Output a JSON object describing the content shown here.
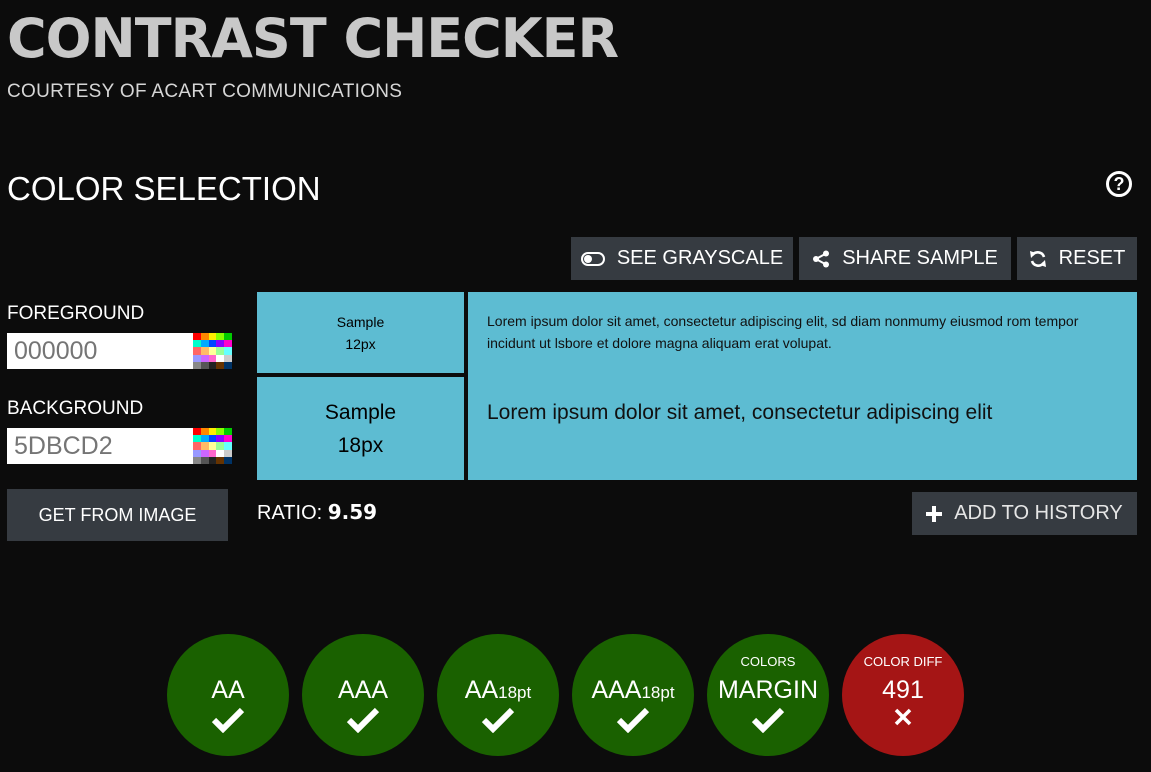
{
  "header": {
    "title": "CONTRAST CHECKER",
    "subtitle": "COURTESY OF ACART COMMUNICATIONS"
  },
  "section": {
    "title": "COLOR SELECTION",
    "help_icon": "question-circle-icon"
  },
  "toolbar": {
    "grayscale_label": "SEE GRAYSCALE",
    "grayscale_icon": "toggle-icon",
    "share_label": "SHARE SAMPLE",
    "share_icon": "share-icon",
    "reset_label": "RESET",
    "reset_icon": "refresh-icon"
  },
  "foreground": {
    "label": "FOREGROUND",
    "placeholder": "000000",
    "value": ""
  },
  "background": {
    "label": "BACKGROUND",
    "placeholder": "5DBCD2",
    "value": "",
    "color": "#5DBCD2"
  },
  "samples": {
    "small_word": "Sample",
    "small_size": "12px",
    "large_word": "Sample",
    "large_size": "18px",
    "lorem_small": "Lorem ipsum dolor sit amet, consectetur adipiscing elit, sd diam nonmumy eiusmod rom tempor incidunt ut lsbore et dolore magna aliquam erat volupat.",
    "lorem_large": "Lorem ipsum dolor sit amet, consectetur adipiscing elit"
  },
  "actions": {
    "get_from_image": "GET FROM IMAGE",
    "add_to_history": "ADD TO HISTORY",
    "add_icon": "plus-icon"
  },
  "ratio": {
    "label": "RATIO:",
    "value": "9.59"
  },
  "results": [
    {
      "top": "",
      "main": "AA",
      "sub": "",
      "status": "pass"
    },
    {
      "top": "",
      "main": "AAA",
      "sub": "",
      "status": "pass"
    },
    {
      "top": "",
      "main": "AA",
      "sub": "18pt",
      "status": "pass"
    },
    {
      "top": "",
      "main": "AAA",
      "sub": "18pt",
      "status": "pass"
    },
    {
      "top": "COLORS",
      "main": "MARGIN",
      "sub": "",
      "status": "pass"
    },
    {
      "top": "COLOR DIFF",
      "main": "491",
      "sub": "",
      "status": "fail"
    }
  ],
  "colors": {
    "page_bg": "#0c0c0c",
    "button_bg": "#363b41",
    "pass": "#1a6100",
    "fail": "#a51515",
    "sample_bg": "#5DBCD2",
    "sample_fg": "#000000"
  }
}
